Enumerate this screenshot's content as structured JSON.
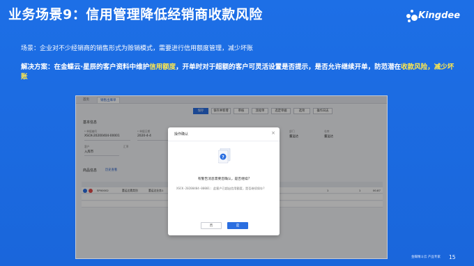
{
  "header": {
    "title": "业务场景9：信用管理降低经销商收款风险"
  },
  "logo": {
    "text": "Kingdee"
  },
  "scene": {
    "text": "场景：企业对不少经销商的销售形式为赊销模式，需要进行信用额度管理，减少坏账"
  },
  "solution": {
    "part1": "解决方案：在金蝶云·星辰的客户资料中维护",
    "hl1": "信用额度",
    "part2": "，开单时对于超额的客户可灵活设置是否提示，是否允许继续开单，防范潜在",
    "hl2": "收款风险",
    "part3": "，",
    "hl3": "减少坏账"
  },
  "app": {
    "tabs": [
      "首页",
      "销售出库单"
    ],
    "toolbar": [
      "保存",
      "保存并新增",
      "审核",
      "流程单",
      "选定单据",
      "选项",
      "操作日志"
    ],
    "section_basic": "基本信息",
    "fields": [
      {
        "label": "* 单据编号",
        "value": "XSCK-20200404-00001"
      },
      {
        "label": "* 单据日期",
        "value": "2020-4-4"
      },
      {
        "label": "业务员",
        "value": ""
      },
      {
        "label": "部门",
        "value": "董运达"
      },
      {
        "label": "仓库",
        "value": "董运达"
      }
    ],
    "fields2": [
      {
        "label": "客户",
        "value": "入库市"
      },
      {
        "label": "汇率",
        "value": ""
      }
    ],
    "section_goods": "商品信息",
    "goods_link": "历史查看",
    "row": {
      "code": "SP00002",
      "name": "董运达素类别",
      "spec": "董运达业务1",
      "qty": "1",
      "price": "1",
      "amount": "00.87"
    }
  },
  "dialog": {
    "title": "操作确认",
    "close": "×",
    "question": "有警告消息需要您确认，是否继续?",
    "message": "XSCK-20200404-00001: 此客户已超出信用额度，是否继续保存?",
    "btn_no": "否",
    "btn_yes": "是"
  },
  "footer": {
    "logo": "金蝶精斗云 产品专家",
    "page": "15"
  }
}
